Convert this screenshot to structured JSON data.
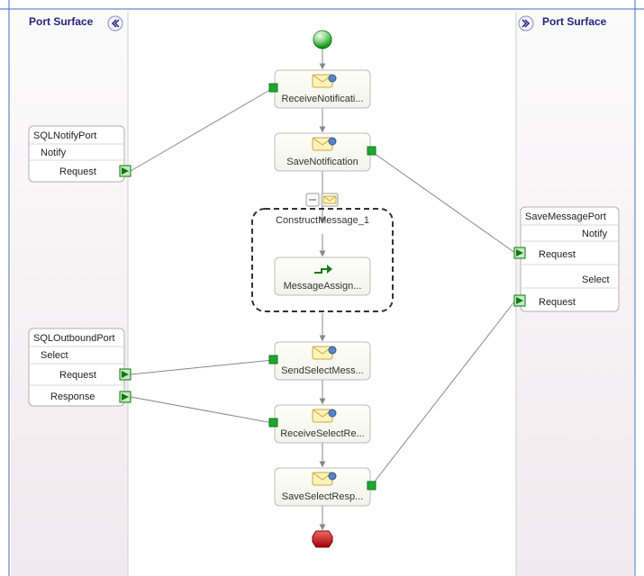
{
  "headers": {
    "left": "Port Surface",
    "right": "Port Surface"
  },
  "ports": {
    "sqlNotify": {
      "title": "SQLNotifyPort",
      "op": "Notify",
      "req": "Request"
    },
    "sqlOutbound": {
      "title": "SQLOutboundPort",
      "op": "Select",
      "req": "Request",
      "resp": "Response"
    },
    "saveMsg": {
      "title": "SaveMessagePort",
      "op1": "Notify",
      "req1": "Request",
      "op2": "Select",
      "req2": "Request"
    }
  },
  "shapes": {
    "receiveNotification": "ReceiveNotificati...",
    "saveNotification": "SaveNotification",
    "constructMessage": "ConstructMessage_1",
    "messageAssign": "MessageAssign...",
    "sendSelectMess": "SendSelectMess...",
    "receiveSelectRe": "ReceiveSelectRe...",
    "saveSelectResp": "SaveSelectResp..."
  }
}
